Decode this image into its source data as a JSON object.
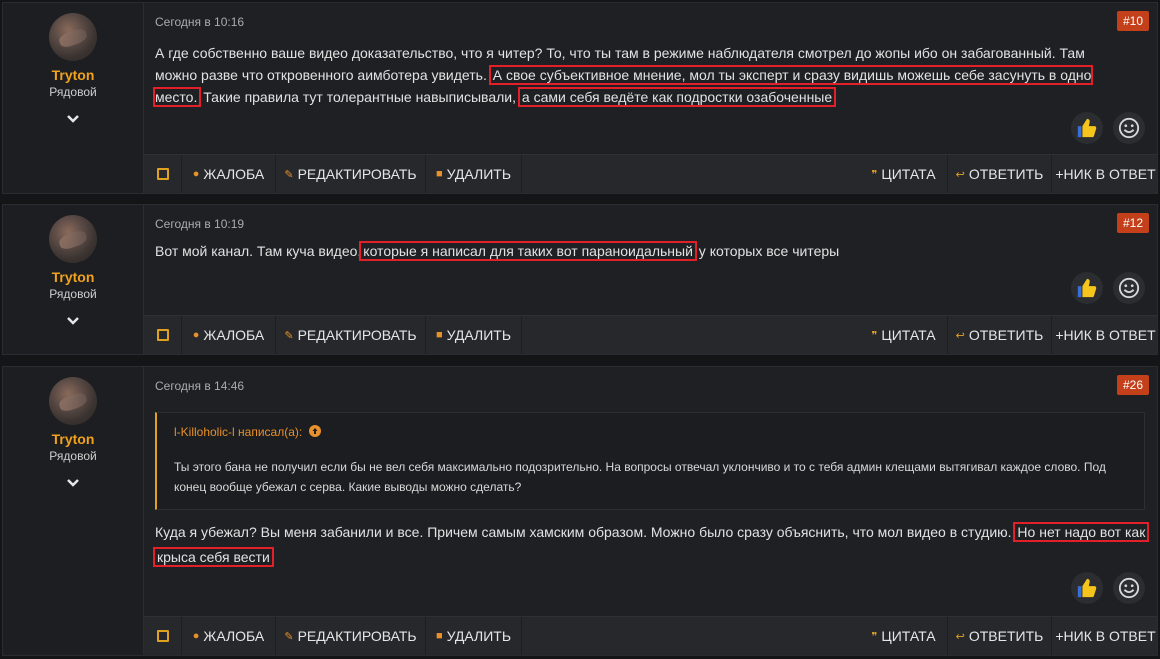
{
  "user": {
    "name": "Tryton",
    "rank": "Рядовой"
  },
  "toolbar": {
    "report": "ЖАЛОБА",
    "edit": "РЕДАКТИРОВАТЬ",
    "delete": "УДАЛИТЬ",
    "quote": "ЦИТАТА",
    "reply": "ОТВЕТИТЬ",
    "nick": "+НИК В ОТВЕТ"
  },
  "posts": [
    {
      "timestamp": "Сегодня в 10:16",
      "number": "#10",
      "text": [
        "А где собственно ваше видео доказательство, что я читер? То, что ты там в режиме наблюдателя смотрел до жопы ибо он забагованный. Там можно разве что откровенного аимботера увидеть.",
        "А свое субъективное мнение, мол ты эксперт и сразу видишь можешь себе засунуть в одно место.",
        " Такие правила тут толерантные навыписывали,",
        "а сами себя ведёте как подростки озабоченные"
      ]
    },
    {
      "timestamp": "Сегодня в 10:19",
      "number": "#12",
      "text": [
        "Вот мой канал. Там куча видео,",
        "которые я написал для таких вот параноидальный",
        " у которых все читеры"
      ]
    },
    {
      "timestamp": "Сегодня в 14:46",
      "number": "#26",
      "quote": {
        "author": "l-Killoholic-l написал(а):",
        "text": "Ты этого бана не получил если бы не вел себя максимально подозрительно. На вопросы отвечал уклончиво и то с тебя админ клещами вытягивал каждое слово. Под конец вообще убежал с серва. Какие выводы можно сделать?"
      },
      "text": [
        "Куда я убежал? Вы меня забанили и все. Причем самым хамским образом. Можно было сразу объяснить, что мол видео в студию.",
        "Но нет надо вот как",
        "крыса себя вести"
      ]
    }
  ],
  "colors": {
    "accent": "#e0a020",
    "badge": "#c3401a",
    "highlight": "#e3202a",
    "username": "#f0a21e"
  }
}
